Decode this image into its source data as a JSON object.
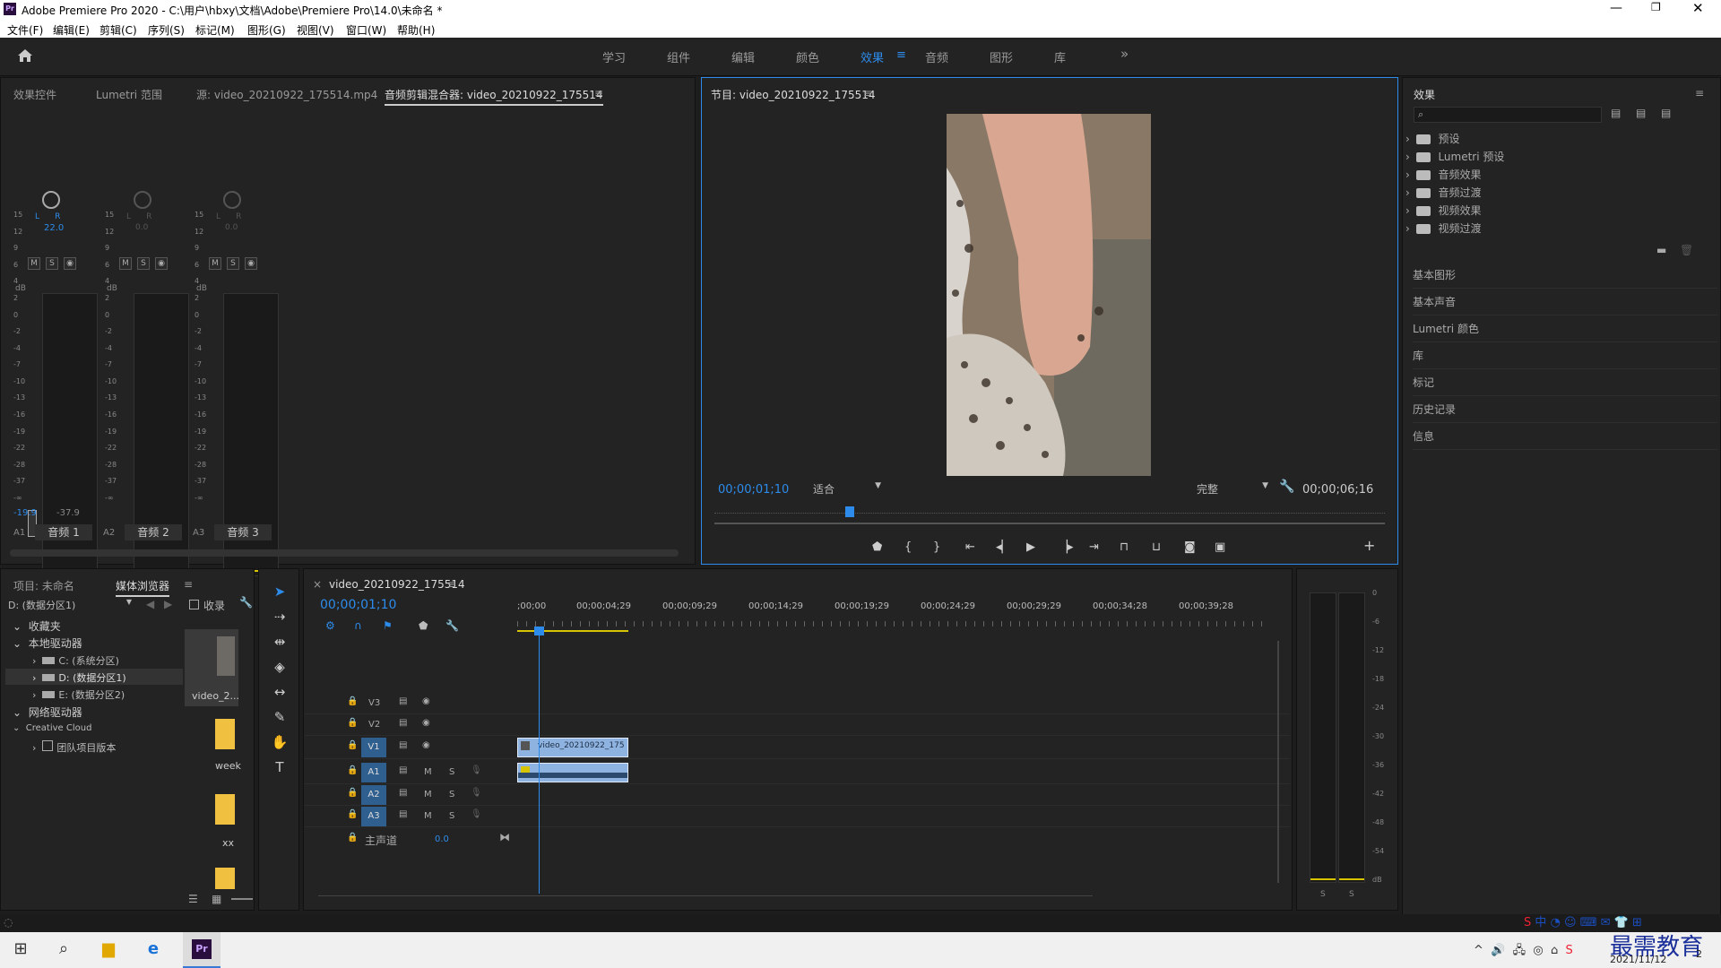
{
  "app": {
    "title": "Adobe Premiere Pro 2020 - C:\\用户\\hbxy\\文档\\Adobe\\Premiere Pro\\14.0\\未命名 *",
    "logo": "Pr"
  },
  "menu": [
    "文件(F)",
    "编辑(E)",
    "剪辑(C)",
    "序列(S)",
    "标记(M)",
    "图形(G)",
    "视图(V)",
    "窗口(W)",
    "帮助(H)"
  ],
  "workspaces": [
    "学习",
    "组件",
    "编辑",
    "颜色",
    "效果",
    "音频",
    "图形",
    "库"
  ],
  "active_workspace": "效果",
  "top_left_tabs": [
    "效果控件",
    "Lumetri 范围",
    "源: video_20210922_175514.mp4",
    "音频剪辑混合器: video_20210922_175514"
  ],
  "mixer": {
    "pan_value": "22.0",
    "pan_value_2": "0.0",
    "pan_value_3": "0.0",
    "db_label": "dB",
    "ticks": [
      "15",
      "12",
      "9",
      "6",
      "4",
      "2",
      "0",
      "-2",
      "-4",
      "-7",
      "-10",
      "-13",
      "-16",
      "-19",
      "-22",
      "-28",
      "-37",
      "-∞"
    ],
    "bottom_values": [
      "-19.9",
      "-37.9"
    ],
    "channels": [
      {
        "id": "A1",
        "name": "音频 1"
      },
      {
        "id": "A2",
        "name": "音频 2"
      },
      {
        "id": "A3",
        "name": "音频 3"
      }
    ]
  },
  "program": {
    "tab": "节目: video_20210922_175514",
    "timecode": "00;00;01;10",
    "fit": "适合",
    "quality": "完整",
    "duration": "00;00;06;16"
  },
  "effects": {
    "title": "效果",
    "search_placeholder": "",
    "folders": [
      "预设",
      "Lumetri 预设",
      "音频效果",
      "音频过渡",
      "视频效果",
      "视频过渡"
    ],
    "sections": [
      "基本图形",
      "基本声音",
      "Lumetri 颜色",
      "库",
      "标记",
      "历史记录",
      "信息"
    ]
  },
  "project": {
    "tabs": [
      "项目: 未命名",
      "媒体浏览器"
    ],
    "drive": "D: (数据分区1)",
    "ingest": "收录",
    "tree": [
      {
        "label": "收藏夹",
        "level": 0
      },
      {
        "label": "本地驱动器",
        "level": 0
      },
      {
        "label": "C: (系统分区)",
        "level": 1
      },
      {
        "label": "D: (数据分区1)",
        "level": 1
      },
      {
        "label": "E: (数据分区2)",
        "level": 1
      },
      {
        "label": "网络驱动器",
        "level": 0
      },
      {
        "label": "Creative Cloud",
        "level": 0
      },
      {
        "label": "团队项目版本",
        "level": 1
      }
    ],
    "thumbs": [
      "video_2...",
      "week",
      "xx"
    ]
  },
  "timeline": {
    "tab": "video_20210922_175514",
    "timecode": "00;00;01;10",
    "ruler": [
      ";00;00",
      "00;00;04;29",
      "00;00;09;29",
      "00;00;14;29",
      "00;00;19;29",
      "00;00;24;29",
      "00;00;29;29",
      "00;00;34;28",
      "00;00;39;28"
    ],
    "video_tracks": [
      "V3",
      "V2",
      "V1"
    ],
    "audio_tracks": [
      "A1",
      "A2",
      "A3"
    ],
    "master": "主声道",
    "master_value": "0.0",
    "clip_name": "video_20210922_175"
  },
  "audio_meter": {
    "ticks": [
      "0",
      "-6",
      "-12",
      "-18",
      "-24",
      "-30",
      "-36",
      "-42",
      "-48",
      "-54",
      "dB"
    ],
    "solo": [
      "S",
      "S"
    ]
  },
  "taskbar": {
    "ime": "中",
    "watermark": "最需教育",
    "date": "2021/11/12",
    "notify": "2"
  },
  "colors": {
    "accent": "#2d8ceb",
    "meter_yellow": "#d6c400",
    "clip_blue": "#8fb3e0"
  }
}
